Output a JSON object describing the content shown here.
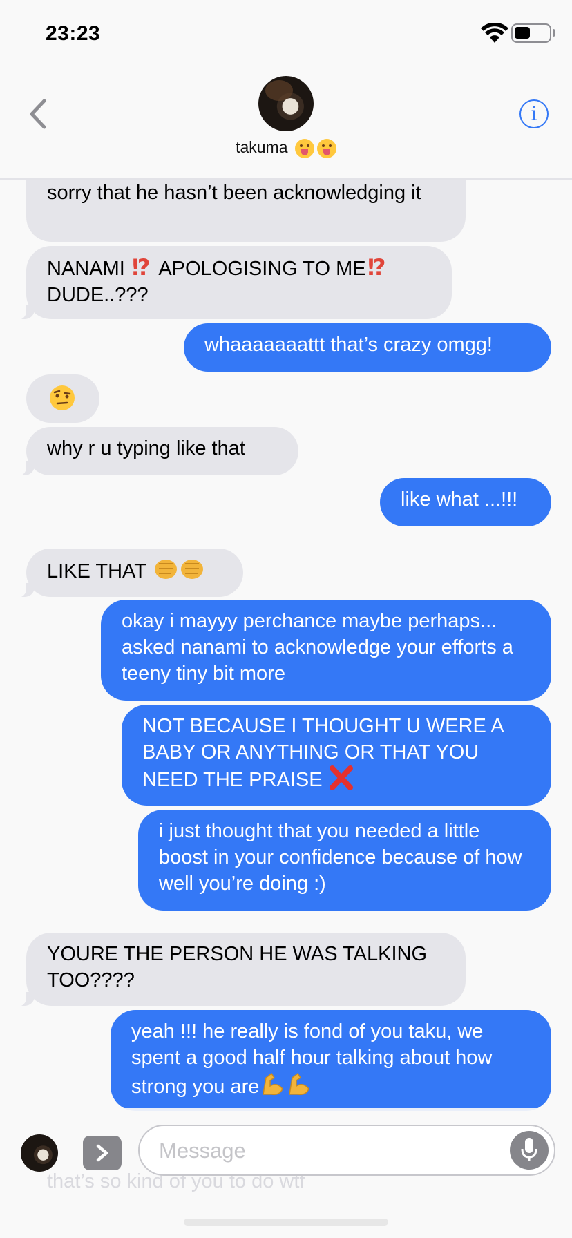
{
  "status_bar": {
    "time": "23:23",
    "battery_level": 0.45
  },
  "header": {
    "contact_name": "takuma"
  },
  "messages": [
    {
      "from": "them",
      "text": "sorry that he hasn’t been acknowledging it"
    },
    {
      "from": "them",
      "parts": [
        "NANAMI",
        "APOLOGISING TO ME",
        "DUDE..???"
      ]
    },
    {
      "from": "me",
      "text": "whaaaaaaattt that’s crazy omgg!"
    },
    {
      "from": "them",
      "icon": "raised-eyebrow-face-icon"
    },
    {
      "from": "them",
      "text": "why r u typing like that"
    },
    {
      "from": "me",
      "text": "like what ...!!!"
    },
    {
      "from": "them",
      "text": "LIKE THAT"
    },
    {
      "from": "me",
      "text": "okay i mayyy perchance maybe perhaps... asked nanami to acknowledge your efforts a teeny tiny bit more"
    },
    {
      "from": "me",
      "text": "NOT BECAUSE I THOUGHT U WERE A BABY OR ANYTHING OR THAT YOU NEED THE PRAISE"
    },
    {
      "from": "me",
      "text": "i just thought that you needed a little boost in your confidence because of how well you’re doing :)"
    },
    {
      "from": "them",
      "text": "YOURE THE PERSON HE WAS TALKING TOO????"
    },
    {
      "from": "me",
      "text": "yeah !!! he really is fond of you taku, we spent a good half hour talking about how strong you are"
    },
    {
      "from": "them",
      "text": "that’s so kind of you to do wtf"
    }
  ],
  "input": {
    "placeholder": "Message"
  },
  "colors": {
    "sent_bubble": "#3478f6",
    "received_bubble": "#e5e5ea",
    "background": "#f9f9f9"
  }
}
